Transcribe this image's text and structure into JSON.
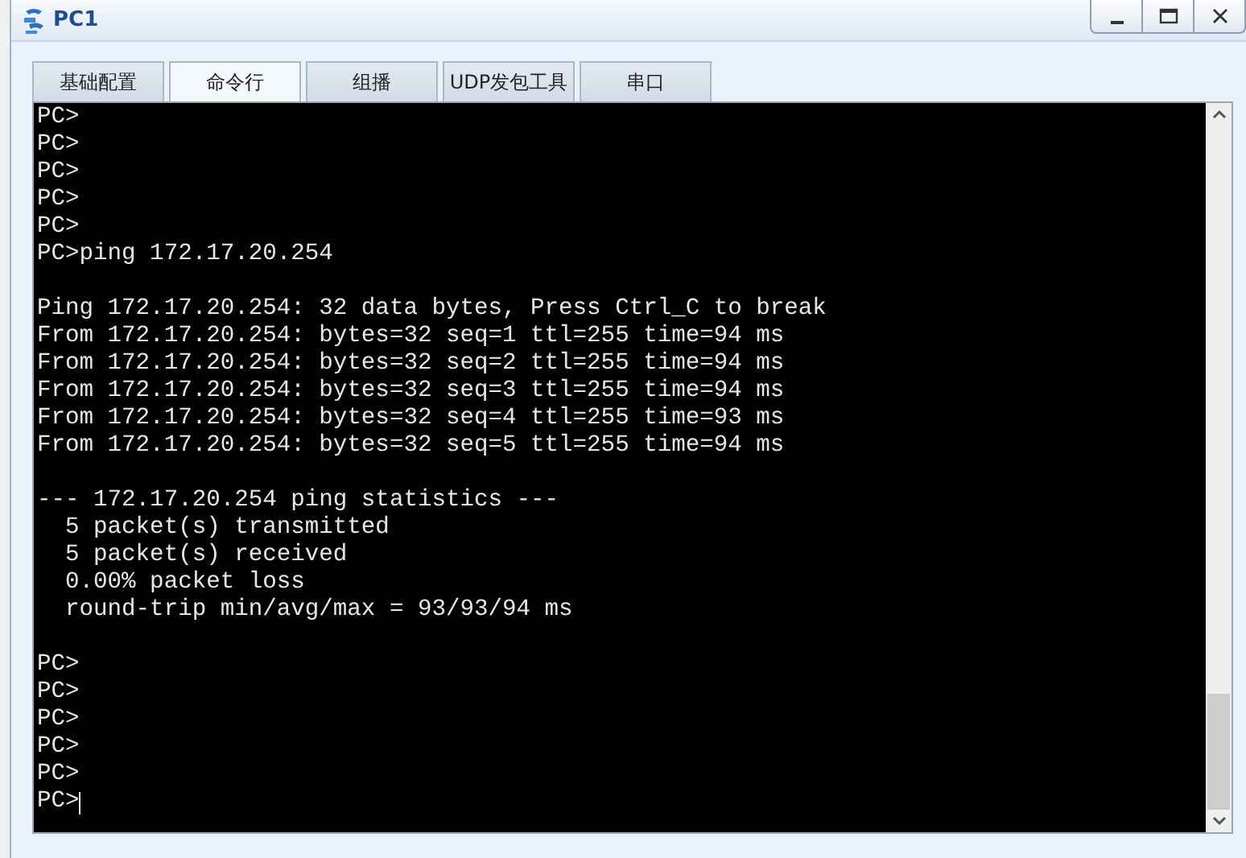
{
  "window": {
    "title": "PC1"
  },
  "tabs": [
    {
      "label": "基础配置",
      "selected": false
    },
    {
      "label": "命令行",
      "selected": true
    },
    {
      "label": "组播",
      "selected": false
    },
    {
      "label": "UDP发包工具",
      "selected": false
    },
    {
      "label": "串口",
      "selected": false
    }
  ],
  "terminal": {
    "blocks": [
      [
        "PC>",
        "PC>",
        "PC>",
        "PC>",
        "PC>",
        "PC>ping 172.17.20.254"
      ],
      [
        "Ping 172.17.20.254: 32 data bytes, Press Ctrl_C to break",
        "From 172.17.20.254: bytes=32 seq=1 ttl=255 time=94 ms",
        "From 172.17.20.254: bytes=32 seq=2 ttl=255 time=94 ms",
        "From 172.17.20.254: bytes=32 seq=3 ttl=255 time=94 ms",
        "From 172.17.20.254: bytes=32 seq=4 ttl=255 time=93 ms",
        "From 172.17.20.254: bytes=32 seq=5 ttl=255 time=94 ms"
      ],
      [
        "--- 172.17.20.254 ping statistics ---",
        "  5 packet(s) transmitted",
        "  5 packet(s) received",
        "  0.00% packet loss",
        "  round-trip min/avg/max = 93/93/94 ms"
      ],
      [
        "PC>",
        "PC>",
        "PC>",
        "PC>",
        "PC>",
        "PC>"
      ]
    ],
    "cursor": true
  }
}
